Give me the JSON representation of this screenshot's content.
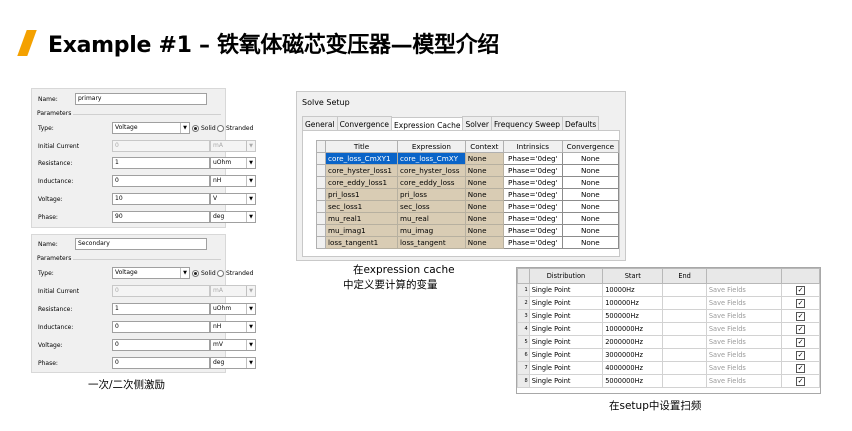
{
  "title": "Example #1 – 铁氧体磁芯变压器—模型介绍",
  "panel1": {
    "name_label": "Name:",
    "name_value": "primary",
    "parameters_label": "Parameters",
    "type_label": "Type:",
    "type_value": "Voltage",
    "solid_label": "Solid",
    "stranded_label": "Stranded",
    "initial_current_label": "Initial Current",
    "initial_current_value": "0",
    "initial_current_unit": "mA",
    "resistance_label": "Resistance:",
    "resistance_value": "1",
    "resistance_unit": "uOhm",
    "inductance_label": "Inductance:",
    "inductance_value": "0",
    "inductance_unit": "nH",
    "voltage_label": "Voltage:",
    "voltage_value": "10",
    "voltage_unit": "V",
    "phase_label": "Phase:",
    "phase_value": "90",
    "phase_unit": "deg"
  },
  "panel2": {
    "name_label": "Name:",
    "name_value": "Secondary",
    "parameters_label": "Parameters",
    "type_label": "Type:",
    "type_value": "Voltage",
    "solid_label": "Solid",
    "stranded_label": "Stranded",
    "initial_current_label": "Initial Current",
    "initial_current_value": "0",
    "initial_current_unit": "mA",
    "resistance_label": "Resistance:",
    "resistance_value": "1",
    "resistance_unit": "uOhm",
    "inductance_label": "Inductance:",
    "inductance_value": "0",
    "inductance_unit": "nH",
    "voltage_label": "Voltage:",
    "voltage_value": "0",
    "voltage_unit": "mV",
    "phase_label": "Phase:",
    "phase_value": "0",
    "phase_unit": "deg"
  },
  "caption_left": "一次/二次侧激励",
  "solve_setup": {
    "title": "Solve Setup",
    "tabs": [
      "General",
      "Convergence",
      "Expression Cache",
      "Solver",
      "Frequency Sweep",
      "Defaults"
    ],
    "active_tab": "Expression Cache",
    "columns": [
      "Title",
      "Expression",
      "Context",
      "Intrinsics",
      "Convergence"
    ],
    "rows": [
      {
        "title": "core_loss_CmXY1",
        "expression": "core_loss_CmXY",
        "context": "None",
        "intrinsics": "Phase='0deg'",
        "convergence": "None"
      },
      {
        "title": "core_hyster_loss1",
        "expression": "core_hyster_loss",
        "context": "None",
        "intrinsics": "Phase='0deg'",
        "convergence": "None"
      },
      {
        "title": "core_eddy_loss1",
        "expression": "core_eddy_loss",
        "context": "None",
        "intrinsics": "Phase='0deg'",
        "convergence": "None"
      },
      {
        "title": "pri_loss1",
        "expression": "pri_loss",
        "context": "None",
        "intrinsics": "Phase='0deg'",
        "convergence": "None"
      },
      {
        "title": "sec_loss1",
        "expression": "sec_loss",
        "context": "None",
        "intrinsics": "Phase='0deg'",
        "convergence": "None"
      },
      {
        "title": "mu_real1",
        "expression": "mu_real",
        "context": "None",
        "intrinsics": "Phase='0deg'",
        "convergence": "None"
      },
      {
        "title": "mu_imag1",
        "expression": "mu_imag",
        "context": "None",
        "intrinsics": "Phase='0deg'",
        "convergence": "None"
      },
      {
        "title": "loss_tangent1",
        "expression": "loss_tangent",
        "context": "None",
        "intrinsics": "Phase='0deg'",
        "convergence": "None"
      }
    ]
  },
  "caption_middle_1": "在expression cache",
  "caption_middle_2": "中定义要计算的变量",
  "freq_sweep": {
    "columns": [
      "Distribution",
      "Start",
      "End",
      "",
      ""
    ],
    "rows": [
      {
        "n": "1",
        "distribution": "Single Point",
        "start": "10000Hz",
        "end": "",
        "save": "Save Fields",
        "checked": "✓"
      },
      {
        "n": "2",
        "distribution": "Single Point",
        "start": "100000Hz",
        "end": "",
        "save": "Save Fields",
        "checked": "✓"
      },
      {
        "n": "3",
        "distribution": "Single Point",
        "start": "500000Hz",
        "end": "",
        "save": "Save Fields",
        "checked": "✓"
      },
      {
        "n": "4",
        "distribution": "Single Point",
        "start": "1000000Hz",
        "end": "",
        "save": "Save Fields",
        "checked": "✓"
      },
      {
        "n": "5",
        "distribution": "Single Point",
        "start": "2000000Hz",
        "end": "",
        "save": "Save Fields",
        "checked": "✓"
      },
      {
        "n": "6",
        "distribution": "Single Point",
        "start": "3000000Hz",
        "end": "",
        "save": "Save Fields",
        "checked": "✓"
      },
      {
        "n": "7",
        "distribution": "Single Point",
        "start": "4000000Hz",
        "end": "",
        "save": "Save Fields",
        "checked": "✓"
      },
      {
        "n": "8",
        "distribution": "Single Point",
        "start": "5000000Hz",
        "end": "",
        "save": "Save Fields",
        "checked": "✓"
      }
    ]
  },
  "caption_right": "在setup中设置扫频",
  "colors": {
    "accent": "#f4a100",
    "selection": "#0a64c8",
    "cell_tan": "#d9ccb4"
  }
}
